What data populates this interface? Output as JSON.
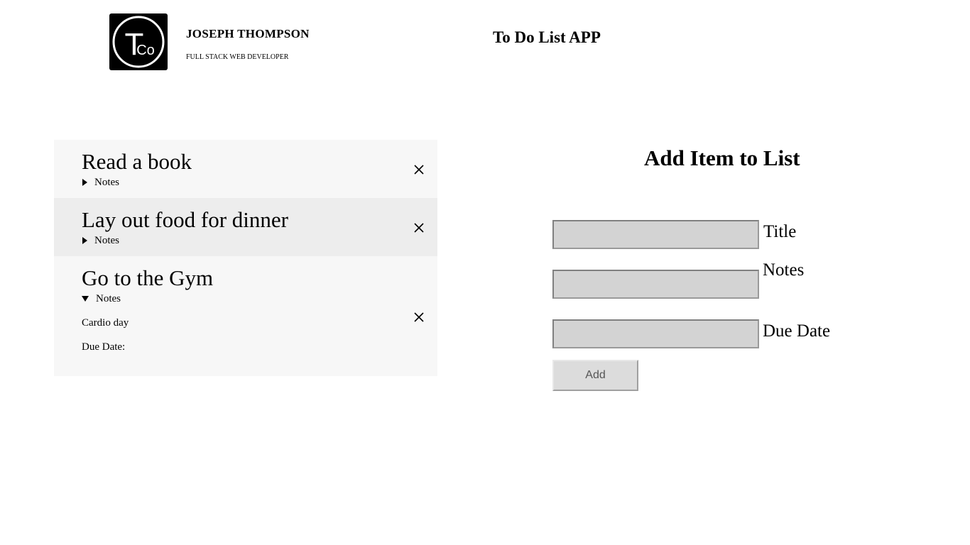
{
  "header": {
    "name": "JOSEPH THOMPSON",
    "tagline": "FULL STACK WEB DEVELOPER",
    "app_title": "To Do List APP",
    "logo": {
      "main_letter": "T",
      "sub_letters": "Co"
    }
  },
  "todos": [
    {
      "title": "Read a book",
      "notes_label": "Notes",
      "expanded": false
    },
    {
      "title": "Lay out food for dinner",
      "notes_label": "Notes",
      "expanded": false
    },
    {
      "title": "Go to the Gym",
      "notes_label": "Notes",
      "expanded": true,
      "note": "Cardio day",
      "due_label": "Due Date:"
    }
  ],
  "form": {
    "title": "Add Item to List",
    "title_label": "Title",
    "notes_label": "Notes",
    "due_label": "Due Date",
    "title_value": "",
    "notes_value": "",
    "due_value": "",
    "add_label": "Add"
  },
  "icons": {
    "close": "close-icon",
    "collapsed": "triangle-right-icon",
    "expanded": "triangle-down-icon"
  },
  "colors": {
    "row_light": "#f7f7f7",
    "row_dark": "#ededed",
    "input_bg": "#d3d3d3"
  }
}
